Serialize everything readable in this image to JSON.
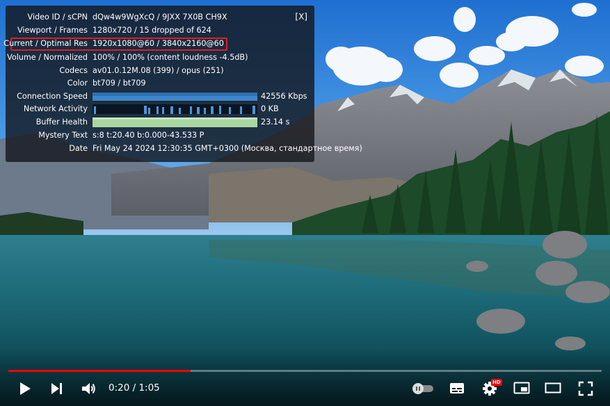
{
  "stats": {
    "close_label": "[X]",
    "rows": [
      {
        "label": "Video ID / sCPN",
        "value": "dQw4w9WgXcQ / 9JXX 7X0B CH9X"
      },
      {
        "label": "Viewport / Frames",
        "value": "1280x720 / 15 dropped of 624"
      },
      {
        "label": "Current / Optimal Res",
        "value": "1920x1080@60 / 3840x2160@60"
      },
      {
        "label": "Volume / Normalized",
        "value": "100% / 100% (content loudness -4.5dB)"
      },
      {
        "label": "Codecs",
        "value": "av01.0.12M.08 (399) / opus (251)"
      },
      {
        "label": "Color",
        "value": "bt709 / bt709"
      },
      {
        "label": "Connection Speed",
        "value": "42556 Kbps"
      },
      {
        "label": "Network Activity",
        "value": "0 KB"
      },
      {
        "label": "Buffer Health",
        "value": "23.14 s"
      },
      {
        "label": "Mystery Text",
        "value": "s:8 t:20.40 b:0.000-43.533 P"
      },
      {
        "label": "Date",
        "value": "Fri May 24 2024 12:30:35 GMT+0300 (Москва, стандартное время)"
      }
    ]
  },
  "player": {
    "current_time": "0:20",
    "duration": "1:05",
    "time_display": "0:20 / 1:05",
    "progress_fraction": 0.3077,
    "hd_badge": "HD"
  },
  "colors": {
    "progress": "#ff0000",
    "highlight": "#e11d1d",
    "connection_bar": "#2f6fb0",
    "network_bar": "#1c66a8",
    "buffer_bar": "#a9d6a0"
  }
}
